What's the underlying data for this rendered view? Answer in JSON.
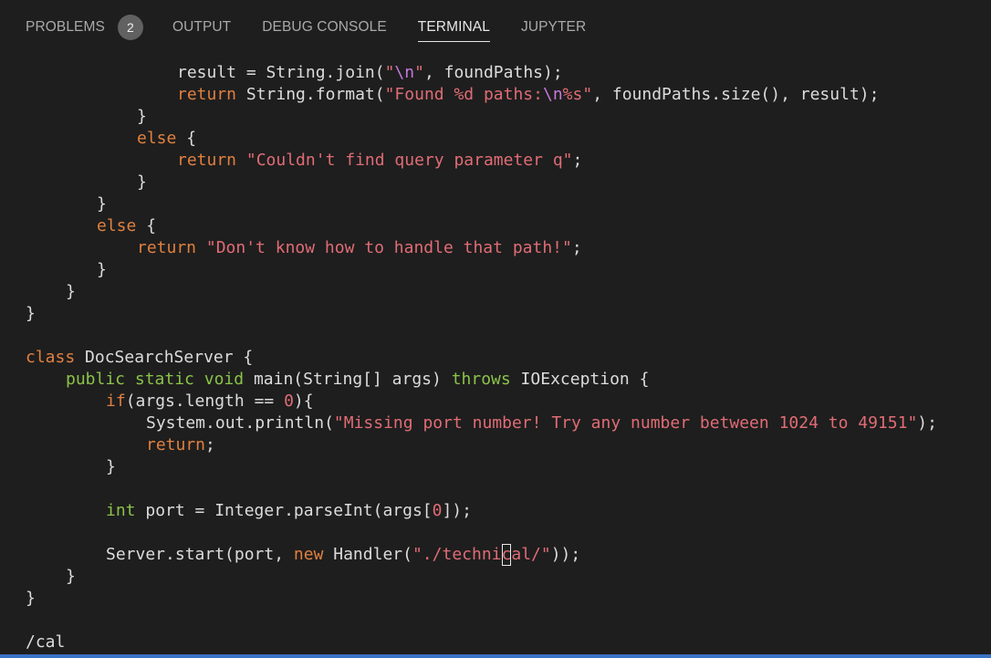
{
  "tabs": [
    {
      "label": "PROBLEMS",
      "badge": "2"
    },
    {
      "label": "OUTPUT"
    },
    {
      "label": "DEBUG CONSOLE"
    },
    {
      "label": "TERMINAL",
      "active": true
    },
    {
      "label": "JUPYTER"
    }
  ],
  "code": {
    "l1": {
      "a": "result = String.join(",
      "b": "\"",
      "c": "\\n",
      "d": "\"",
      "e": ", foundPaths);"
    },
    "l2": {
      "a": "return",
      "b": " String.format(",
      "c": "\"Found %d paths:",
      "d": "\\n",
      "e": "%s\"",
      "f": ", foundPaths.size(), result);"
    },
    "l3": "}",
    "l4": {
      "a": "else",
      "b": " {"
    },
    "l5": {
      "a": "return",
      "b": " ",
      "c": "\"Couldn't find query parameter q\"",
      "d": ";"
    },
    "l6": "}",
    "l7": "}",
    "l8": {
      "a": "else",
      "b": " {"
    },
    "l9": {
      "a": "return",
      "b": " ",
      "c": "\"Don't know how to handle that path!\"",
      "d": ";"
    },
    "l10": "}",
    "l11": "}",
    "l12": "}",
    "l13": {
      "a": "class",
      "b": " DocSearchServer {"
    },
    "l14": {
      "a": "public",
      "b": " ",
      "c": "static",
      "d": " ",
      "e": "void",
      "f": " main(String[] args) ",
      "g": "throws",
      "h": " IOException {"
    },
    "l15": {
      "a": "if",
      "b": "(args.length == ",
      "c": "0",
      "d": "){"
    },
    "l16": {
      "a": "System.out.println(",
      "b": "\"Missing port number! Try any number between 1024 to 49151\"",
      "c": ");"
    },
    "l17": {
      "a": "return",
      "b": ";"
    },
    "l18": "}",
    "l19": {
      "a": "int",
      "b": " port = Integer.parseInt(args[",
      "c": "0",
      "d": "]);"
    },
    "l20": {
      "a": "Server.start(port, ",
      "b": "new",
      "c": " Handler(",
      "d": "\"./techni",
      "e": "c",
      "f": "al/\"",
      "g": "));"
    },
    "l21": "}",
    "l22": "}",
    "l23": "/cal"
  },
  "colors": {
    "background": "#1e1e1e",
    "keyword": "#e08040",
    "type_keyword": "#8bc34a",
    "string": "#e06c75",
    "escape": "#c678dd",
    "status_bar": "#3b73c6"
  }
}
